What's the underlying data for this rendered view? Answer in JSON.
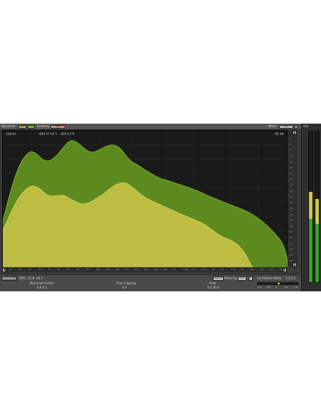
{
  "header": {
    "spectrum_label": "Spectrum",
    "chip_a_label": "INT",
    "chip_b_label": "",
    "underlay_label": "Underlay",
    "underlay_value": "PGM",
    "mode_label": "Mode",
    "mode_value": "CUS"
  },
  "display": {
    "cursor_left": "-100 Hz",
    "cursor_mid": "-649 37 CH 1",
    "cursor_mid2": "-309 0.5 R",
    "cursor_right": "-60 dB",
    "curves": {
      "outer_color": "#5c8a1f",
      "inner_color": "#bdbd42"
    }
  },
  "ruler": {
    "ticks": [
      "3",
      "6",
      "9",
      "12",
      "15",
      "18",
      "21",
      "24",
      "27",
      "30",
      "33",
      "36",
      "39",
      "42",
      "45",
      "48",
      "51",
      "54",
      "57",
      "60",
      "63",
      "66"
    ]
  },
  "freq_axis": {
    "ticks": [
      "10",
      "16",
      "20",
      "25",
      "30",
      "40",
      "50",
      "63",
      "80",
      "100",
      "125",
      "200",
      "315",
      "400",
      "500",
      "630",
      "800",
      "1k",
      "1.25k",
      "2k",
      "2.5k",
      "4k",
      "5k",
      "6.3k",
      "8k",
      "10k",
      "12k",
      "16k",
      "20k"
    ]
  },
  "stats": {
    "statistics_btn": "Statistics",
    "rms_label": "RMS",
    "rms_value": "-21.8 -46.7",
    "max_crest_label": "Max Crest Factor",
    "max_crest_value": "0.8 0.4",
    "peak_clipping_label": "Peak Clipping",
    "peak_clipping_value": "0 0",
    "peak_label": "Peak",
    "peak_value": "0.5 20.6",
    "reset_btn": "Reset",
    "metering_label": "Metering",
    "metering_value": "AES",
    "correlation_label": "Correlation Meter",
    "correlation_value": "0.4 0.2",
    "corr_scale": [
      "-1.0",
      "-0.5",
      "0",
      "0.5",
      "1.0"
    ]
  },
  "output": {
    "label": "Out",
    "left_level": 0.6,
    "right_level": 0.55,
    "scale": [
      "0",
      "-3",
      "-6",
      "-10",
      "-15",
      "-20",
      "-25",
      "-30",
      "-40",
      "-50",
      "-60"
    ]
  }
}
